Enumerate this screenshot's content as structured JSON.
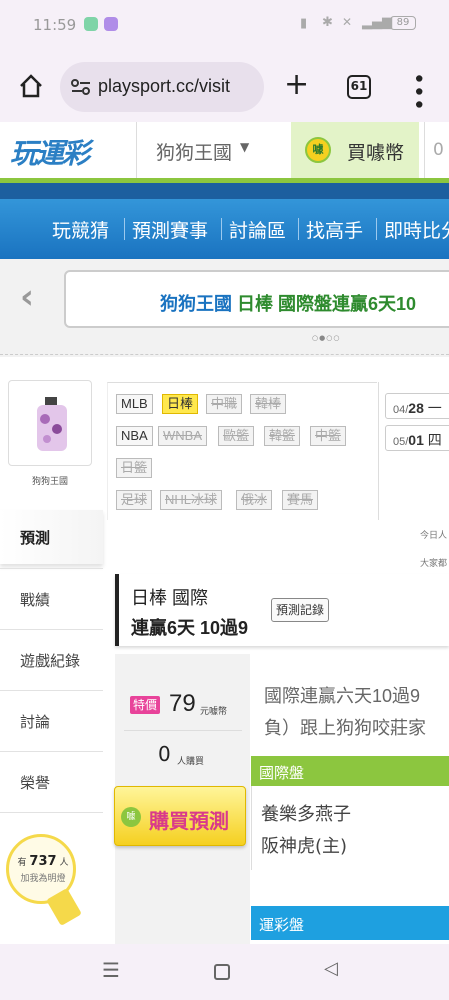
{
  "status_bar": {
    "time": "11:59",
    "battery": "89"
  },
  "browser": {
    "url": "playsport.cc/visit",
    "tab_count": "61"
  },
  "site": {
    "logo_text": "玩運彩",
    "user_menu": "狗狗王國",
    "buy_coin": "買噱幣",
    "coin_count": "0",
    "coin_badge": "噱"
  },
  "nav": {
    "items": [
      "玩競猜",
      "預測賽事",
      "討論區",
      "找高手",
      "即時比分"
    ]
  },
  "banner": {
    "text_user": "狗狗王國",
    "text_rest": "日棒 國際盤連贏6天10"
  },
  "profile": {
    "name": "狗狗王國"
  },
  "sports": {
    "row1": [
      "MLB",
      "日棒",
      "中職",
      "韓棒"
    ],
    "row2": [
      "NBA",
      "WNBA",
      "歐籃",
      "韓籃",
      "中籃"
    ],
    "row3": [
      "日籃"
    ],
    "row4": [
      "足球",
      "NHL冰球",
      "俄冰",
      "賽馬"
    ]
  },
  "dates": {
    "d1_prefix": "04/",
    "d1_day": "28",
    "d1_week": "一",
    "d2_prefix": "05/",
    "d2_day": "01",
    "d2_week": "四"
  },
  "side_menu": {
    "predict": "預測",
    "record": "戰績",
    "game_log": "遊戲紀錄",
    "discuss": "討論",
    "honor": "榮譽",
    "light_prefix": "有",
    "light_count": "737",
    "light_suffix": "人",
    "light_sub": "加我為明燈"
  },
  "right_small": {
    "today": "今日人",
    "everyone": "大家都"
  },
  "record": {
    "league": "日棒 國際",
    "streak": "連贏6天 10過9",
    "history_button": "預測記錄"
  },
  "price": {
    "badge": "特價",
    "amount": "79",
    "unit": "元噱幣",
    "buyers": "0",
    "buyers_unit": "人購買",
    "buy_button": "購買預測",
    "buy_icon": "噱"
  },
  "desc": {
    "line1": "國際連贏六天10過9",
    "line2": "負）跟上狗狗咬莊家"
  },
  "intl": {
    "title": "國際盤",
    "team1": "養樂多燕子",
    "team2": "阪神虎(主)"
  },
  "lottery": {
    "title": "運彩盤"
  },
  "colors": {
    "brand_green": "#8cc63f",
    "nav_blue": "#1a73c0",
    "gold": "#f5d020"
  }
}
